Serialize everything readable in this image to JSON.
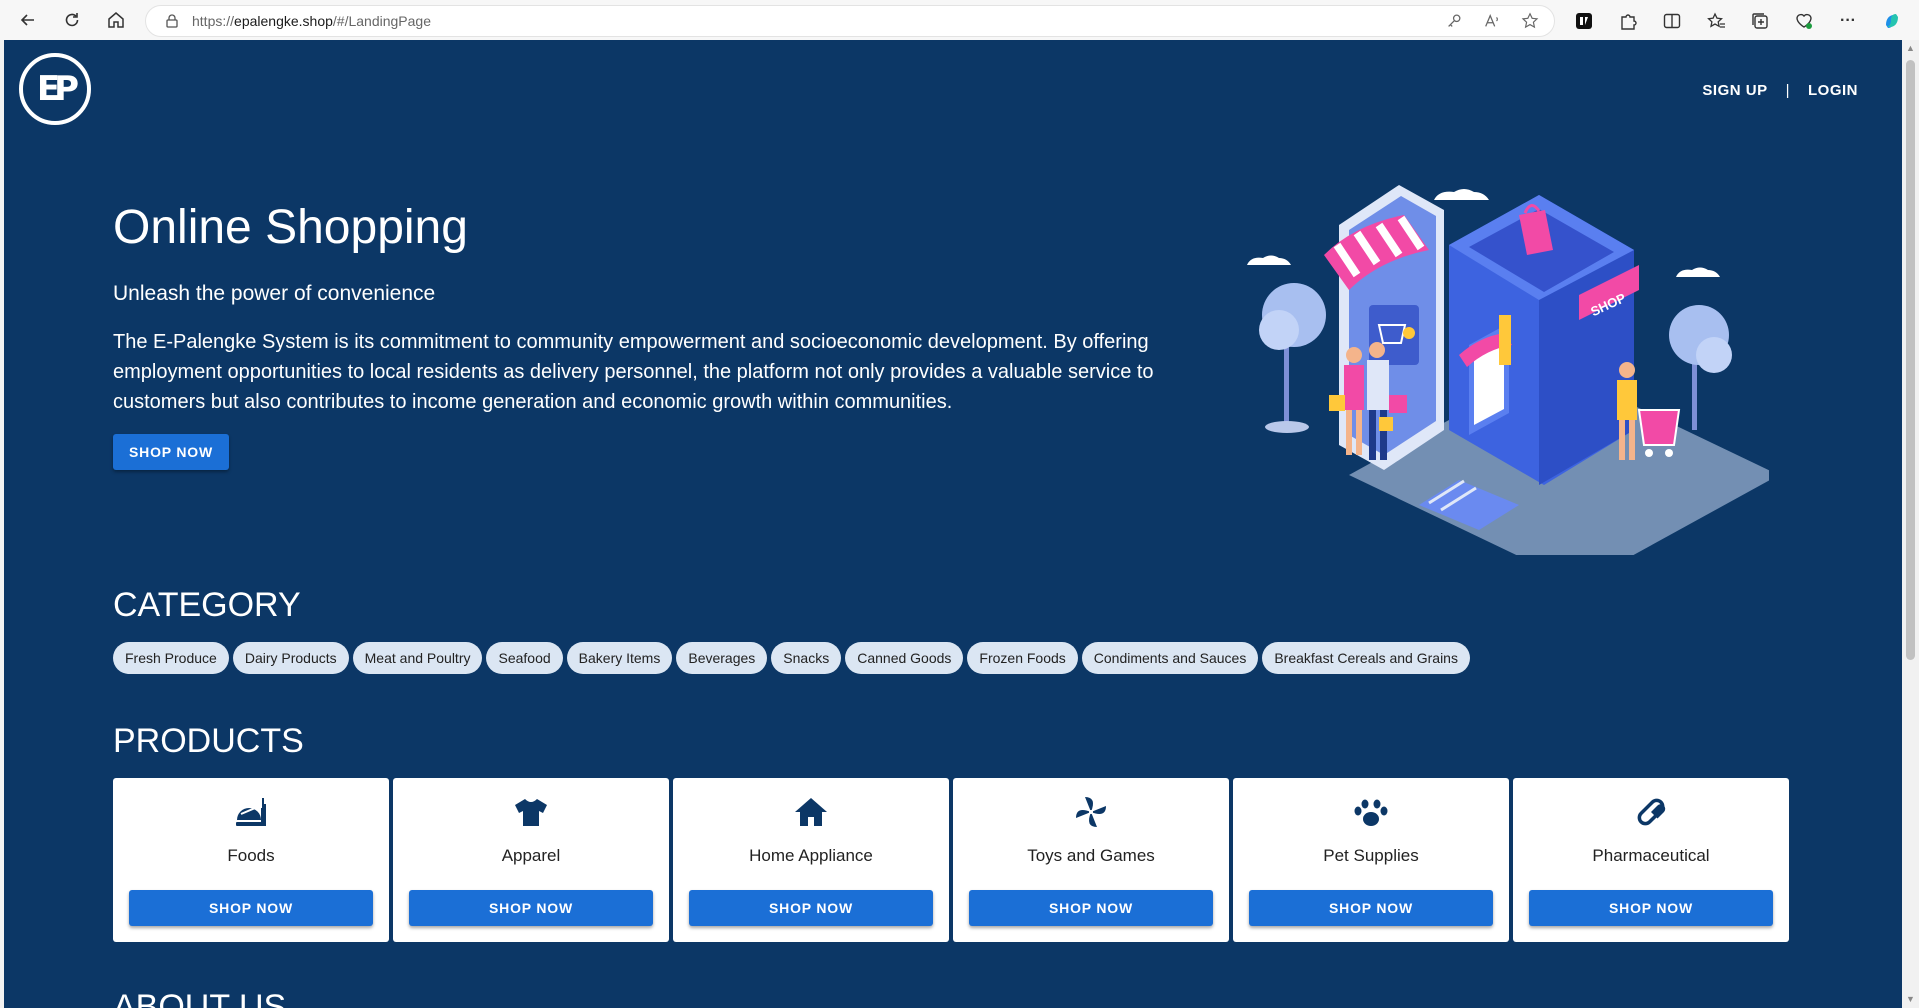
{
  "browser": {
    "url_prefix": "https://",
    "url_domain": "epalengke.shop",
    "url_path": "/#/LandingPage",
    "menu_glyph": "···"
  },
  "header": {
    "logo_text": "EP",
    "nav": {
      "signup": "SIGN UP",
      "separator": "|",
      "login": "LOGIN"
    }
  },
  "hero": {
    "title": "Online Shopping",
    "subtitle": "Unleash the power of convenience",
    "description": "The E-Palengke System is its commitment to community empowerment and socioeconomic development. By offering employment opportunities to local residents as delivery personnel, the platform not only provides a valuable service to customers but also contributes to income generation and economic growth within communities.",
    "button": "SHOP NOW",
    "illustration_sign": "SHOP"
  },
  "category": {
    "title": "CATEGORY",
    "items": [
      "Fresh Produce",
      "Dairy Products",
      "Meat and Poultry",
      "Seafood",
      "Bakery Items",
      "Beverages",
      "Snacks",
      "Canned Goods",
      "Frozen Foods",
      "Condiments and Sauces",
      "Breakfast Cereals and Grains"
    ]
  },
  "products": {
    "title": "PRODUCTS",
    "items": [
      {
        "name": "Foods",
        "icon": "food-icon",
        "button": "SHOP NOW"
      },
      {
        "name": "Apparel",
        "icon": "shirt-icon",
        "button": "SHOP NOW"
      },
      {
        "name": "Home Appliance",
        "icon": "home-icon",
        "button": "SHOP NOW"
      },
      {
        "name": "Toys and Games",
        "icon": "pinwheel-icon",
        "button": "SHOP NOW"
      },
      {
        "name": "Pet Supplies",
        "icon": "paw-icon",
        "button": "SHOP NOW"
      },
      {
        "name": "Pharmaceutical",
        "icon": "pill-icon",
        "button": "SHOP NOW"
      }
    ]
  },
  "about": {
    "title": "ABOUT US"
  },
  "colors": {
    "page_bg": "#0c3766",
    "button": "#1b6fd6",
    "chip": "#dbe6f3"
  }
}
